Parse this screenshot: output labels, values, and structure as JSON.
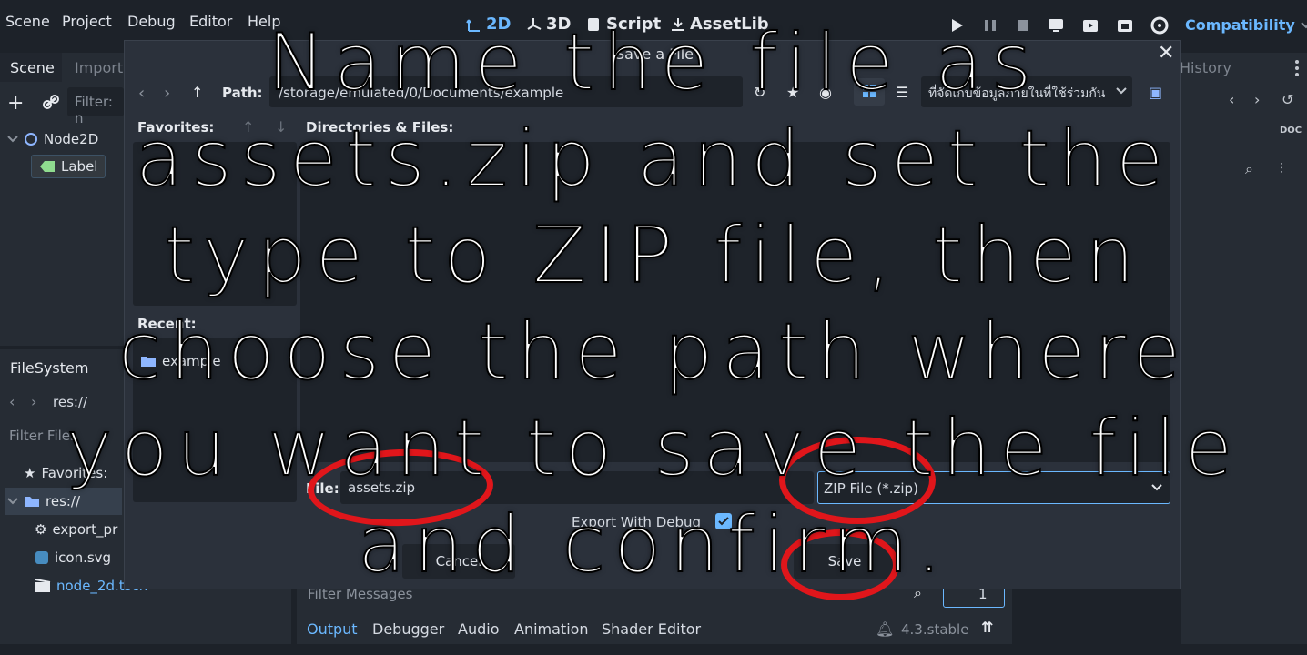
{
  "menu": [
    "Scene",
    "Project",
    "Debug",
    "Editor",
    "Help"
  ],
  "workspaces": {
    "w2d": "2D",
    "w3d": "3D",
    "script": "Script",
    "assetlib": "AssetLib"
  },
  "renderer": "Compatibility",
  "scene_dock": {
    "tabs": [
      "Scene",
      "Import"
    ],
    "filter_placeholder": "Filter: n",
    "nodes": [
      {
        "name": "Node2D"
      },
      {
        "name": "Label"
      }
    ]
  },
  "filesystem_dock": {
    "title": "FileSystem",
    "path": "res://",
    "filter_placeholder": "Filter Files",
    "items": [
      "Favorites:",
      "res://",
      "export_pr",
      "icon.svg",
      "node_2d.tscn"
    ]
  },
  "right_dock": {
    "tab": "History"
  },
  "dialog": {
    "title": "Save a File",
    "path_label": "Path:",
    "path_value": "/storage/emulated/0/Documents/example",
    "drive": "ที่จัดเก็บข้อมูลภายในที่ใช้ร่วมกัน",
    "favorites_label": "Favorites:",
    "dirs_label": "Directories & Files:",
    "recent_label": "Recent:",
    "recent_items": [
      "example"
    ],
    "file_label": "File:",
    "file_value": "assets.zip",
    "filter_value": "ZIP File (*.zip)",
    "export_debug_label": "Export With Debug",
    "export_debug_checked": true,
    "cancel_label": "Cancel",
    "save_label": "Save"
  },
  "bottom_panel": {
    "filter_placeholder": "Filter Messages",
    "tabs": [
      "Output",
      "Debugger",
      "Audio",
      "Animation",
      "Shader Editor"
    ],
    "version": "4.3.stable",
    "count": "1"
  },
  "overlay_lines": [
    "Name the file as",
    "assets.zip and set the",
    "type to ZIP file, then",
    "choose the path where",
    "you want to save the file",
    "and confirm."
  ],
  "colors": {
    "accent": "#6bb8ff",
    "highlight": "#e0161b",
    "dialog_bg": "#2b313b"
  }
}
